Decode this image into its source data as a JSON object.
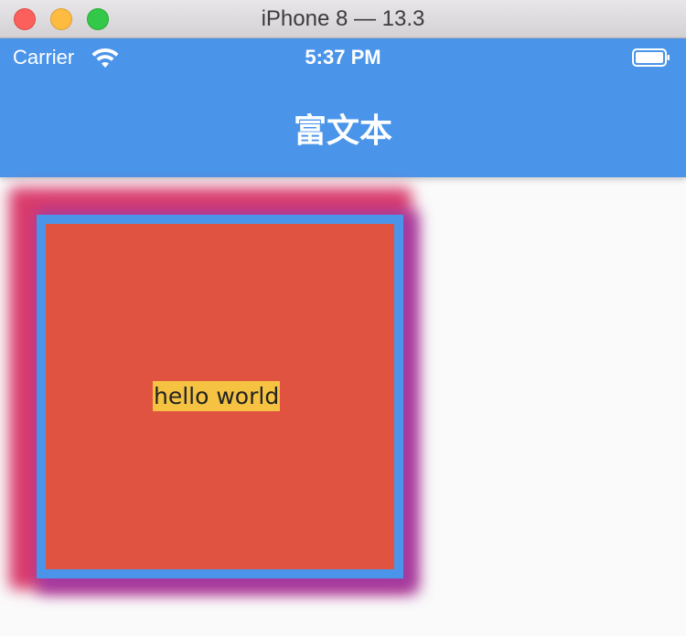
{
  "window": {
    "title": "iPhone 8 — 13.3"
  },
  "status_bar": {
    "carrier": "Carrier",
    "time": "5:37 PM",
    "icons": [
      "wifi-icon",
      "battery-icon"
    ]
  },
  "nav_bar": {
    "title": "富文本"
  },
  "content": {
    "text": "hello world"
  },
  "colors": {
    "app_bar": "#4a95ea",
    "box_fill": "#e05341",
    "box_border": "#4a95ea",
    "shadow_pink": "#d93b6c",
    "shadow_purple": "#a33aa0",
    "text_highlight": "#f5c242"
  }
}
